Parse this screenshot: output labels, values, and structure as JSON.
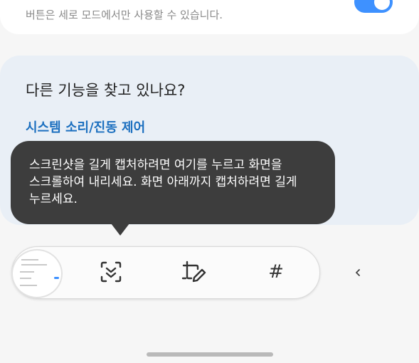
{
  "top_setting": {
    "title": "",
    "subtitle": "버튼은 세로 모드에서만 사용할 수 있습니다.",
    "toggle_state": "on",
    "toggle_color": "#3e91ff"
  },
  "find_features": {
    "heading": "다른 기능을 찾고 있나요?",
    "link": "시스템 소리/진동 제어",
    "link_color": "#1b6fbf"
  },
  "tooltip": {
    "line1": "스크린샷을 길게 캡처하려면 여기를 누르고 화면을",
    "line2": "스크롤하여 내리세요. 화면 아래까지 캡처하려면 길게",
    "line3": "누르세요."
  },
  "toolbar": {
    "thumbnail": "screenshot-thumbnail",
    "buttons": [
      {
        "icon": "scroll-capture-icon"
      },
      {
        "icon": "crop-edit-icon"
      },
      {
        "icon": "hashtag-icon",
        "glyph": "#"
      }
    ],
    "collapse_icon": "chevron-left-icon",
    "collapse_glyph": "<"
  }
}
